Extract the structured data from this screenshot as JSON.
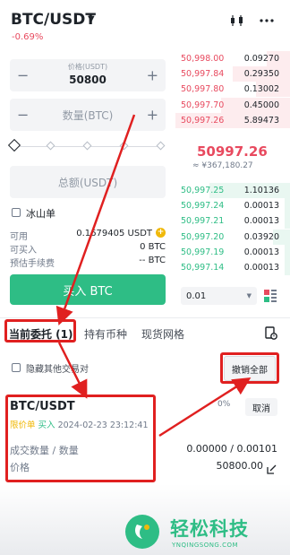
{
  "header": {
    "pair": "BTC/USDT",
    "change": "-0.69%",
    "chart_icon": "candlestick-icon",
    "menu_icon": "more-dots-icon"
  },
  "form": {
    "price_label": "价格(USDT)",
    "price_value": "50800",
    "amount_placeholder": "数量(BTC)",
    "total_placeholder": "总额(USDT)",
    "iceberg_label": "冰山单",
    "available_label": "可用",
    "available_value": "0.1679405 USDT",
    "can_buy_label": "可买入",
    "can_buy_value": "0 BTC",
    "fee_label": "预估手续费",
    "fee_value": "-- BTC",
    "buy_button": "买入 BTC"
  },
  "order_book": {
    "asks": [
      {
        "price": "50,998.00",
        "qty": "0.09270",
        "depth": 0.2
      },
      {
        "price": "50,997.84",
        "qty": "0.29350",
        "depth": 0.5
      },
      {
        "price": "50,997.80",
        "qty": "0.13002",
        "depth": 0.3
      },
      {
        "price": "50,997.70",
        "qty": "0.45000",
        "depth": 0.6
      },
      {
        "price": "50,997.26",
        "qty": "5.89473",
        "depth": 1.0
      }
    ],
    "mid_price": "50997.26",
    "mid_fiat": "≈ ¥367,180.27",
    "bids": [
      {
        "price": "50,997.25",
        "qty": "1.10136",
        "depth": 0.7
      },
      {
        "price": "50,997.24",
        "qty": "0.00013",
        "depth": 0.05
      },
      {
        "price": "50,997.21",
        "qty": "0.00013",
        "depth": 0.05
      },
      {
        "price": "50,997.20",
        "qty": "0.03920",
        "depth": 0.15
      },
      {
        "price": "50,997.19",
        "qty": "0.00013",
        "depth": 0.05
      },
      {
        "price": "50,997.14",
        "qty": "0.00013",
        "depth": 0.05
      }
    ],
    "precision": "0.01"
  },
  "tabs": {
    "open_orders": "当前委托 (1)",
    "holdings": "持有币种",
    "grid": "现货网格"
  },
  "filters": {
    "hide_others": "隐藏其他交易对",
    "cancel_all": "撤销全部"
  },
  "order": {
    "pair": "BTC/USDT",
    "type": "限价单",
    "side": "买入",
    "time": "2024-02-23 23:12:41",
    "progress": "0%",
    "cancel": "取消",
    "filled_label": "成交数量 / 数量",
    "filled_value": "0.00000 / 0.00101",
    "price_label": "价格",
    "price_value": "50800.00"
  },
  "watermark": {
    "brand": "轻松科技",
    "domain": "YNQINGSONG.COM"
  },
  "colors": {
    "green": "#2ebd85",
    "red": "#e84a5f",
    "annotation": "#e02020",
    "yellow": "#f0b90b"
  }
}
